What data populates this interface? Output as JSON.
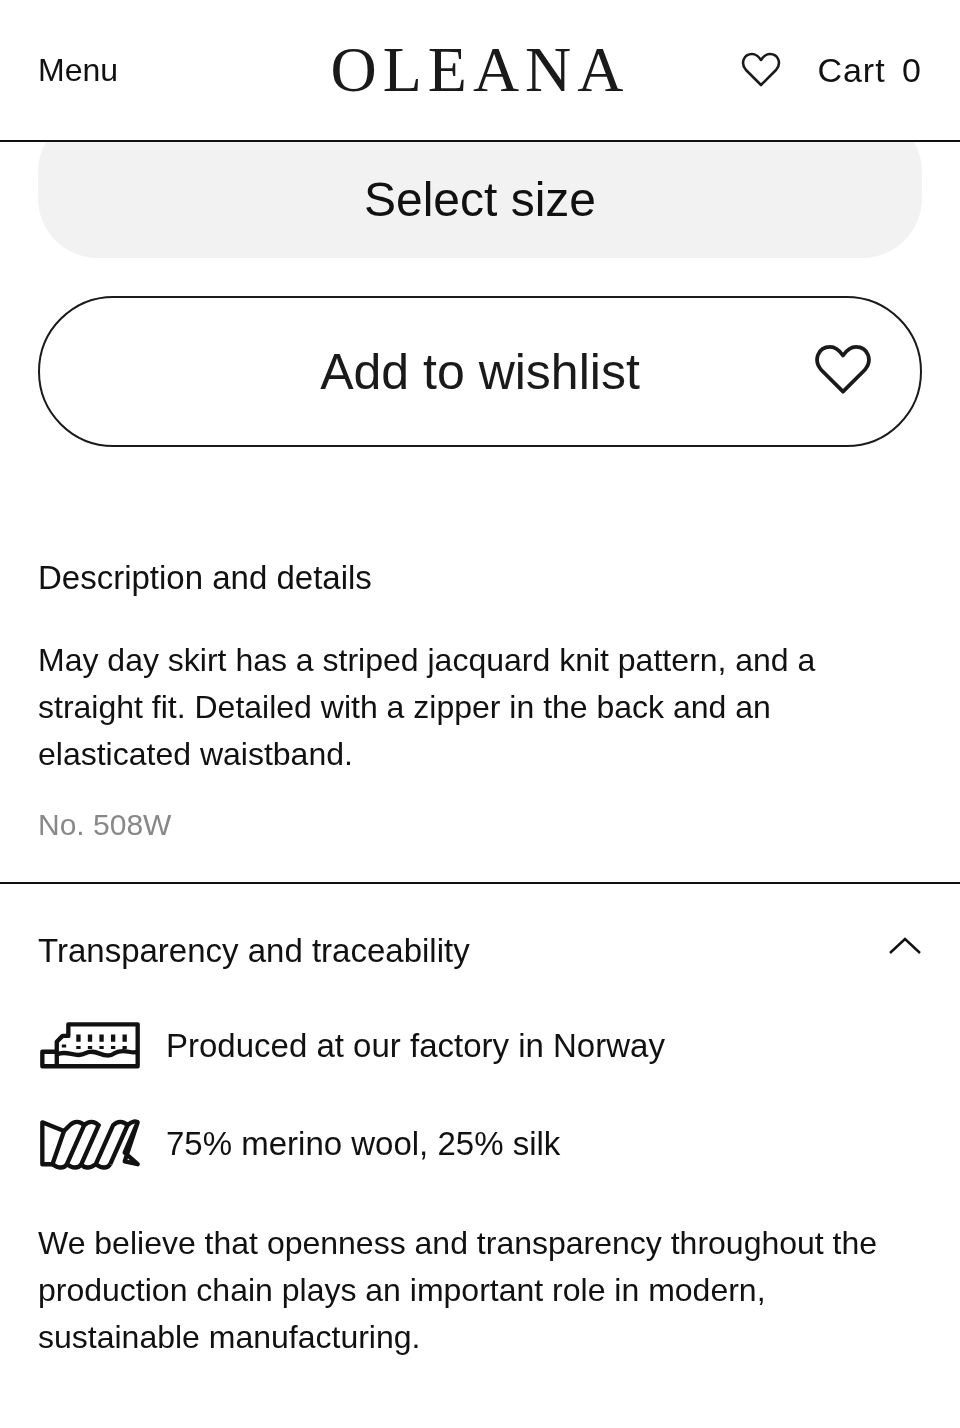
{
  "header": {
    "menu": "Menu",
    "logo": "OLEANA",
    "cart": "Cart",
    "cart_count": "0"
  },
  "select_size": "Select size",
  "wishlist_button": "Add to wishlist",
  "description": {
    "title": "Description and details",
    "text": "May day skirt has a striped jacquard knit pattern, and a straight fit. Detailed with a zipper in the back and an elasticated waistband.",
    "number": "No. 508W"
  },
  "transparency": {
    "title": "Transparency and traceability",
    "expanded": true,
    "features": [
      {
        "kind": "factory",
        "text": "Produced at our factory in Norway"
      },
      {
        "kind": "yarn",
        "text": "75% merino wool, 25% silk"
      }
    ],
    "text": "We believe that openness and transparency throughout the production chain plays an important role in modern, sustainable manufacturing."
  }
}
